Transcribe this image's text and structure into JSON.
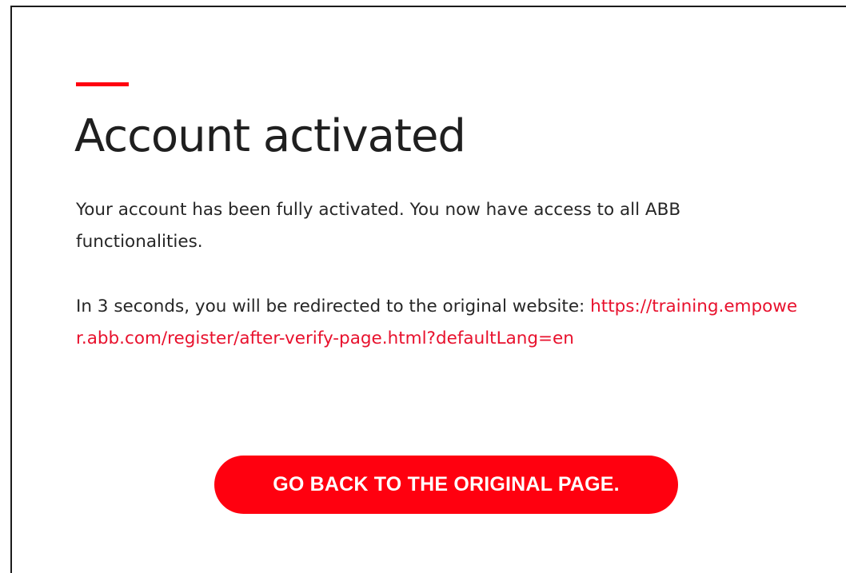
{
  "page": {
    "title": "Account activated",
    "message": "Your account has been fully activated. You now have access to all ABB functionalities.",
    "redirect_text": "In 3 seconds, you will be redirected to the original website:",
    "redirect_link": "https://training.empower.abb.com/register/after-verify-page.html?defaultLang=en",
    "button_label": "GO BACK TO THE ORIGINAL PAGE."
  },
  "colors": {
    "accent": "#ff000f",
    "link": "#e8112d",
    "heading": "#1f1f1f",
    "text": "#262626"
  }
}
